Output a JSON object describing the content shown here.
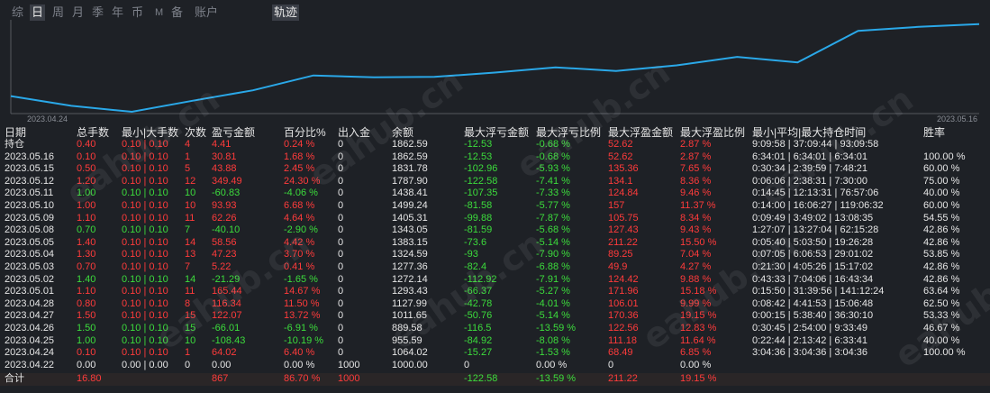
{
  "tabs": [
    "综",
    "日",
    "周",
    "月",
    "季",
    "年",
    "币",
    "M",
    "备",
    "账户",
    "轨迹"
  ],
  "active_tabs": [
    "日",
    "轨迹"
  ],
  "chart_data": {
    "type": "line",
    "x": [
      "2023.04.24",
      "2023.04.25",
      "2023.04.26",
      "2023.04.27",
      "2023.04.28",
      "2023.05.01",
      "2023.05.02",
      "2023.05.03",
      "2023.05.04",
      "2023.05.05",
      "2023.05.08",
      "2023.05.09",
      "2023.05.10",
      "2023.05.11",
      "2023.05.12",
      "2023.05.15",
      "2023.05.16"
    ],
    "series": [
      {
        "values": [
          1064.02,
          955.59,
          889.58,
          1011.65,
          1127.99,
          1293.43,
          1272.14,
          1277.36,
          1324.59,
          1383.15,
          1343.05,
          1405.31,
          1499.24,
          1438.41,
          1787.9,
          1831.78,
          1862.59
        ]
      }
    ],
    "x_start_label": "2023.04.24",
    "x_end_label": "2023.05.16",
    "color": "#2aa8e8"
  },
  "headers": [
    "日期",
    "总手数",
    "最小|大手数",
    "次数",
    "盈亏金额",
    "百分比%",
    "出入金",
    "余额",
    "最大浮亏金额",
    "最大浮亏比例",
    "最大浮盈金额",
    "最大浮盈比例",
    "最小|平均|最大持仓时间",
    "胜率"
  ],
  "holding_row": {
    "date": "持仓",
    "lots": "0.40",
    "minmax": "0.10 | 0.10",
    "count": "4",
    "pnl": "4.41",
    "pct": "0.24 %",
    "io": "0",
    "balance": "1862.59",
    "max_dd": "-12.53",
    "max_dd_pct": "-0.68 %",
    "max_fp": "52.62",
    "max_fp_pct": "2.87 %",
    "hold": "9:09:58 | 37:09:44 | 93:09:58",
    "win": ""
  },
  "rows": [
    {
      "date": "2023.05.16",
      "lots": "0.10",
      "minmax": "0.10 | 0.10",
      "count": "1",
      "pnl": "30.81",
      "pct": "1.68 %",
      "io": "0",
      "balance": "1862.59",
      "max_dd": "-12.53",
      "max_dd_pct": "-0.68 %",
      "max_fp": "52.62",
      "max_fp_pct": "2.87 %",
      "hold": "6:34:01 | 6:34:01 | 6:34:01",
      "win": "100.00 %",
      "color": "red"
    },
    {
      "date": "2023.05.15",
      "lots": "0.50",
      "minmax": "0.10 | 0.10",
      "count": "5",
      "pnl": "43.88",
      "pct": "2.45 %",
      "io": "0",
      "balance": "1831.78",
      "max_dd": "-102.96",
      "max_dd_pct": "-5.93 %",
      "max_fp": "135.36",
      "max_fp_pct": "7.65 %",
      "hold": "0:30:34 | 2:39:59 | 7:48:21",
      "win": "60.00 %",
      "color": "red"
    },
    {
      "date": "2023.05.12",
      "lots": "1.20",
      "minmax": "0.10 | 0.10",
      "count": "12",
      "pnl": "349.49",
      "pct": "24.30 %",
      "io": "0",
      "balance": "1787.90",
      "max_dd": "-122.58",
      "max_dd_pct": "-7.41 %",
      "max_fp": "134.1",
      "max_fp_pct": "8.36 %",
      "hold": "0:06:06 | 2:38:31 | 7:30:00",
      "win": "75.00 %",
      "color": "red"
    },
    {
      "date": "2023.05.11",
      "lots": "1.00",
      "minmax": "0.10 | 0.10",
      "count": "10",
      "pnl": "-60.83",
      "pct": "-4.06 %",
      "io": "0",
      "balance": "1438.41",
      "max_dd": "-107.35",
      "max_dd_pct": "-7.33 %",
      "max_fp": "124.84",
      "max_fp_pct": "9.46 %",
      "hold": "0:14:45 | 12:13:31 | 76:57:06",
      "win": "40.00 %",
      "color": "green"
    },
    {
      "date": "2023.05.10",
      "lots": "1.00",
      "minmax": "0.10 | 0.10",
      "count": "10",
      "pnl": "93.93",
      "pct": "6.68 %",
      "io": "0",
      "balance": "1499.24",
      "max_dd": "-81.58",
      "max_dd_pct": "-5.77 %",
      "max_fp": "157",
      "max_fp_pct": "11.37 %",
      "hold": "0:14:00 | 16:06:27 | 119:06:32",
      "win": "60.00 %",
      "color": "red"
    },
    {
      "date": "2023.05.09",
      "lots": "1.10",
      "minmax": "0.10 | 0.10",
      "count": "11",
      "pnl": "62.26",
      "pct": "4.64 %",
      "io": "0",
      "balance": "1405.31",
      "max_dd": "-99.88",
      "max_dd_pct": "-7.87 %",
      "max_fp": "105.75",
      "max_fp_pct": "8.34 %",
      "hold": "0:09:49 | 3:49:02 | 13:08:35",
      "win": "54.55 %",
      "color": "red"
    },
    {
      "date": "2023.05.08",
      "lots": "0.70",
      "minmax": "0.10 | 0.10",
      "count": "7",
      "pnl": "-40.10",
      "pct": "-2.90 %",
      "io": "0",
      "balance": "1343.05",
      "max_dd": "-81.59",
      "max_dd_pct": "-5.68 %",
      "max_fp": "127.43",
      "max_fp_pct": "9.43 %",
      "hold": "1:27:07 | 13:27:04 | 62:15:28",
      "win": "42.86 %",
      "color": "green"
    },
    {
      "date": "2023.05.05",
      "lots": "1.40",
      "minmax": "0.10 | 0.10",
      "count": "14",
      "pnl": "58.56",
      "pct": "4.42 %",
      "io": "0",
      "balance": "1383.15",
      "max_dd": "-73.6",
      "max_dd_pct": "-5.14 %",
      "max_fp": "211.22",
      "max_fp_pct": "15.50 %",
      "hold": "0:05:40 | 5:03:50 | 19:26:28",
      "win": "42.86 %",
      "color": "red"
    },
    {
      "date": "2023.05.04",
      "lots": "1.30",
      "minmax": "0.10 | 0.10",
      "count": "13",
      "pnl": "47.23",
      "pct": "3.70 %",
      "io": "0",
      "balance": "1324.59",
      "max_dd": "-93",
      "max_dd_pct": "-7.90 %",
      "max_fp": "89.25",
      "max_fp_pct": "7.04 %",
      "hold": "0:07:05 | 6:06:53 | 29:01:02",
      "win": "53.85 %",
      "color": "red"
    },
    {
      "date": "2023.05.03",
      "lots": "0.70",
      "minmax": "0.10 | 0.10",
      "count": "7",
      "pnl": "5.22",
      "pct": "0.41 %",
      "io": "0",
      "balance": "1277.36",
      "max_dd": "-82.4",
      "max_dd_pct": "-6.88 %",
      "max_fp": "49.9",
      "max_fp_pct": "4.27 %",
      "hold": "0:21:30 | 4:05:26 | 15:17:02",
      "win": "42.86 %",
      "color": "red"
    },
    {
      "date": "2023.05.02",
      "lots": "1.40",
      "minmax": "0.10 | 0.10",
      "count": "14",
      "pnl": "-21.29",
      "pct": "-1.65 %",
      "io": "0",
      "balance": "1272.14",
      "max_dd": "-112.92",
      "max_dd_pct": "-7.91 %",
      "max_fp": "124.42",
      "max_fp_pct": "9.88 %",
      "hold": "0:43:33 | 7:04:06 | 16:43:34",
      "win": "42.86 %",
      "color": "green"
    },
    {
      "date": "2023.05.01",
      "lots": "1.10",
      "minmax": "0.10 | 0.10",
      "count": "11",
      "pnl": "165.44",
      "pct": "14.67 %",
      "io": "0",
      "balance": "1293.43",
      "max_dd": "-66.37",
      "max_dd_pct": "-5.27 %",
      "max_fp": "171.96",
      "max_fp_pct": "15.18 %",
      "hold": "0:15:50 | 31:39:56 | 141:12:24",
      "win": "63.64 %",
      "color": "red"
    },
    {
      "date": "2023.04.28",
      "lots": "0.80",
      "minmax": "0.10 | 0.10",
      "count": "8",
      "pnl": "116.34",
      "pct": "11.50 %",
      "io": "0",
      "balance": "1127.99",
      "max_dd": "-42.78",
      "max_dd_pct": "-4.01 %",
      "max_fp": "106.01",
      "max_fp_pct": "9.99 %",
      "hold": "0:08:42 | 4:41:53 | 15:06:48",
      "win": "62.50 %",
      "color": "red"
    },
    {
      "date": "2023.04.27",
      "lots": "1.50",
      "minmax": "0.10 | 0.10",
      "count": "15",
      "pnl": "122.07",
      "pct": "13.72 %",
      "io": "0",
      "balance": "1011.65",
      "max_dd": "-50.76",
      "max_dd_pct": "-5.14 %",
      "max_fp": "170.36",
      "max_fp_pct": "19.15 %",
      "hold": "0:00:15 | 5:38:40 | 36:30:10",
      "win": "53.33 %",
      "color": "red"
    },
    {
      "date": "2023.04.26",
      "lots": "1.50",
      "minmax": "0.10 | 0.10",
      "count": "15",
      "pnl": "-66.01",
      "pct": "-6.91 %",
      "io": "0",
      "balance": "889.58",
      "max_dd": "-116.5",
      "max_dd_pct": "-13.59 %",
      "max_fp": "122.56",
      "max_fp_pct": "12.83 %",
      "hold": "0:30:45 | 2:54:00 | 9:33:49",
      "win": "46.67 %",
      "color": "green"
    },
    {
      "date": "2023.04.25",
      "lots": "1.00",
      "minmax": "0.10 | 0.10",
      "count": "10",
      "pnl": "-108.43",
      "pct": "-10.19 %",
      "io": "0",
      "balance": "955.59",
      "max_dd": "-84.92",
      "max_dd_pct": "-8.08 %",
      "max_fp": "111.18",
      "max_fp_pct": "11.64 %",
      "hold": "0:22:44 | 2:13:42 | 6:33:41",
      "win": "40.00 %",
      "color": "green"
    },
    {
      "date": "2023.04.24",
      "lots": "0.10",
      "minmax": "0.10 | 0.10",
      "count": "1",
      "pnl": "64.02",
      "pct": "6.40 %",
      "io": "0",
      "balance": "1064.02",
      "max_dd": "-15.27",
      "max_dd_pct": "-1.53 %",
      "max_fp": "68.49",
      "max_fp_pct": "6.85 %",
      "hold": "3:04:36 | 3:04:36 | 3:04:36",
      "win": "100.00 %",
      "color": "red"
    },
    {
      "date": "2023.04.22",
      "lots": "0.00",
      "minmax": "0.00 | 0.00",
      "count": "0",
      "pnl": "0.00",
      "pct": "0.00 %",
      "io": "1000",
      "balance": "1000.00",
      "max_dd": "0",
      "max_dd_pct": "0.00 %",
      "max_fp": "0",
      "max_fp_pct": "0.00 %",
      "hold": "",
      "win": "",
      "color": "white"
    }
  ],
  "total_row": {
    "date": "合计",
    "lots": "16.80",
    "minmax": "",
    "count": "",
    "pnl": "867",
    "pct": "86.70 %",
    "io": "1000",
    "balance": "",
    "max_dd": "-122.58",
    "max_dd_pct": "-13.59 %",
    "max_fp": "211.22",
    "max_fp_pct": "19.15 %",
    "hold": "",
    "win": ""
  },
  "watermark": "eahub.cn"
}
